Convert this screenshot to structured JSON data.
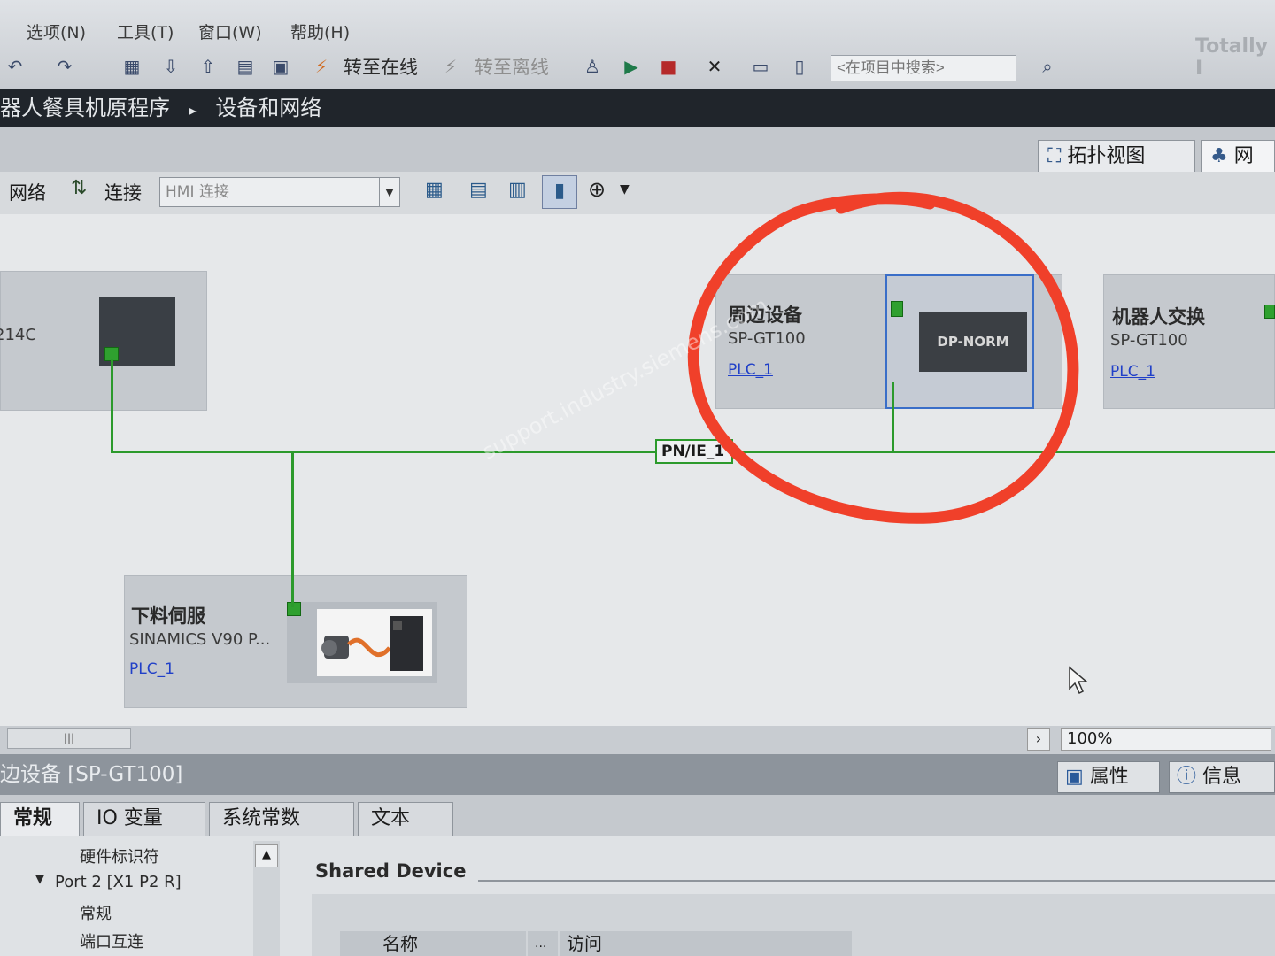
{
  "menu": {
    "options": "选项(N)",
    "tools": "工具(T)",
    "window": "窗口(W)",
    "help": "帮助(H)"
  },
  "toolbar": {
    "go_online": "转至在线",
    "go_offline": "转至离线",
    "search_placeholder": "<在项目中搜索>",
    "brand": "Totally I"
  },
  "breadcrumb": {
    "project": "器人餐具机原程序",
    "separator": "▸",
    "current": "设备和网络"
  },
  "view_tabs": {
    "topology": "拓扑视图",
    "network": "网络"
  },
  "network_toolbar": {
    "network": "网络",
    "connections": "连接",
    "connection_type": "HMI 连接"
  },
  "devices": [
    {
      "partial_label": "214C"
    },
    {
      "name": "周边设备",
      "type": "SP-GT100",
      "link": "PLC_1",
      "module": "DP-NORM"
    },
    {
      "name": "机器人交换",
      "type": "SP-GT100",
      "link": "PLC_1"
    },
    {
      "name": "下料伺服",
      "type": "SINAMICS V90 P...",
      "link": "PLC_1"
    }
  ],
  "network": {
    "label": "PN/IE_1"
  },
  "status": {
    "zoom": "100%"
  },
  "inspector": {
    "title": "边设备 [SP-GT100]",
    "tab_properties": "属性",
    "tab_info": "信息",
    "tabs": [
      "常规",
      "IO 变量",
      "系统常数",
      "文本"
    ],
    "tree": [
      "硬件标识符",
      "Port 2 [X1 P2 R]",
      "常规",
      "端口互连"
    ],
    "section": "Shared Device",
    "columns": [
      "名称",
      "...",
      "访问"
    ]
  },
  "watermark": "support.industry.siemens.com",
  "colors": {
    "highlight_circle": "#f0402a",
    "network_line": "#2c9a2c",
    "link": "#2140c8"
  }
}
